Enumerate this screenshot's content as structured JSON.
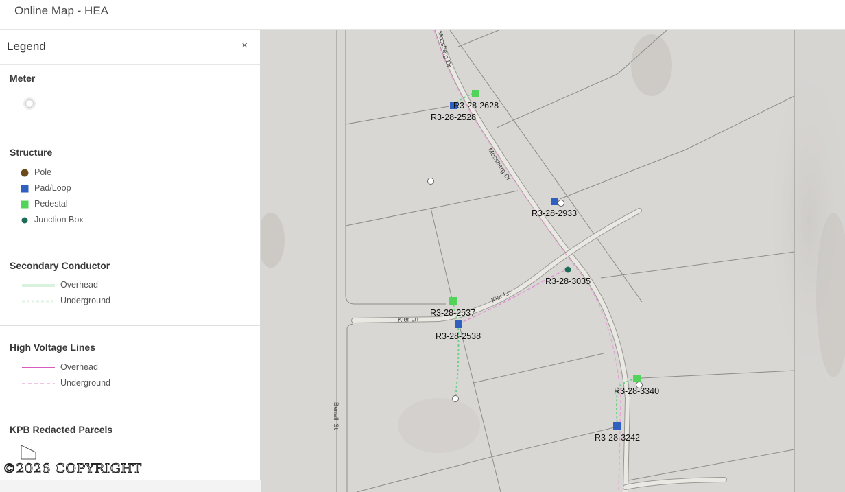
{
  "header": {
    "title": "Online Map - HEA"
  },
  "legend": {
    "title": "Legend",
    "close_icon": "×",
    "sections": {
      "meter": {
        "title": "Meter"
      },
      "structure": {
        "title": "Structure",
        "items": [
          "Pole",
          "Pad/Loop",
          "Pedestal",
          "Junction Box"
        ],
        "colors": {
          "pole": "#6b4a1c",
          "pad_loop": "#2f5fbf",
          "pedestal": "#52d45a",
          "junction_box": "#1e6b57"
        }
      },
      "secondary_conductor": {
        "title": "Secondary Conductor",
        "items": [
          "Overhead",
          "Underground"
        ]
      },
      "high_voltage_lines": {
        "title": "High Voltage Lines",
        "items": [
          "Overhead",
          "Underground"
        ],
        "color": "#d65ac0"
      },
      "parcels": {
        "title": "KPB Redacted Parcels"
      }
    }
  },
  "copyright": "©2026 COPYRIGHT",
  "map": {
    "roads": [
      "Mossberg Dr",
      "Mossberg Dr",
      "Kier Ln",
      "Kier Ln",
      "Benelli St"
    ],
    "labels": [
      "R3-28-2628",
      "R3-28-2528",
      "R3-28-2933",
      "R3-28-3035",
      "R3-28-2537",
      "R3-28-2538",
      "R3-28-3340",
      "R3-28-3242"
    ]
  }
}
